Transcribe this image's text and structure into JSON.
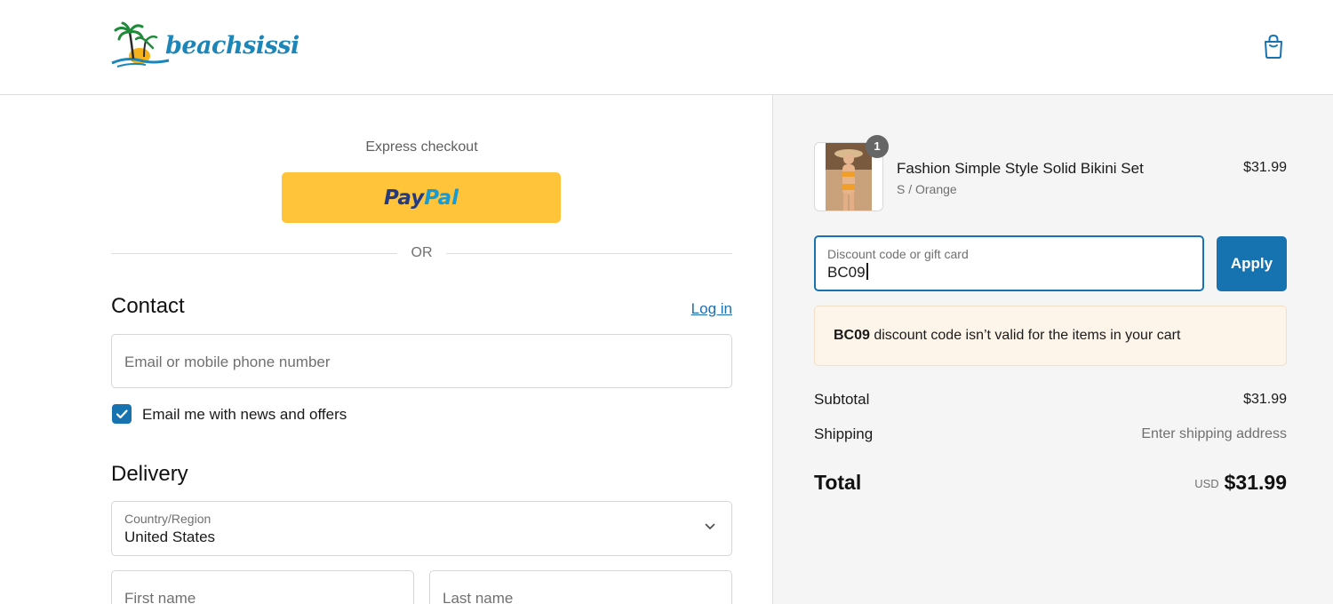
{
  "header": {
    "logo_text": "beachsissi",
    "cart_icon": "shopping-bag-icon"
  },
  "express": {
    "label": "Express checkout",
    "paypal_part1": "Pay",
    "paypal_part2": "Pal",
    "or_text": "OR"
  },
  "contact": {
    "title": "Contact",
    "login_link": "Log in",
    "email_placeholder": "Email or mobile phone number",
    "newsletter_checked": true,
    "newsletter_label": "Email me with news and offers"
  },
  "delivery": {
    "title": "Delivery",
    "country_label": "Country/Region",
    "country_value": "United States",
    "first_name_placeholder": "First name",
    "last_name_placeholder": "Last name"
  },
  "order": {
    "item": {
      "name": "Fashion Simple Style Solid Bikini Set",
      "variant": "S / Orange",
      "price": "$31.99",
      "quantity": "1"
    },
    "discount": {
      "label": "Discount code or gift card",
      "value": "BC09",
      "apply_label": "Apply"
    },
    "alert": {
      "code": "BC09",
      "message": " discount code isn’t valid for the items in your cart"
    },
    "subtotal_label": "Subtotal",
    "subtotal_value": "$31.99",
    "shipping_label": "Shipping",
    "shipping_value": "Enter shipping address",
    "total_label": "Total",
    "total_currency": "USD",
    "total_value": "$31.99"
  },
  "colors": {
    "accent": "#1773b0",
    "paypal_yellow": "#ffc439",
    "alert_bg": "#fef5ea",
    "logo_blue": "#1c86b8"
  }
}
